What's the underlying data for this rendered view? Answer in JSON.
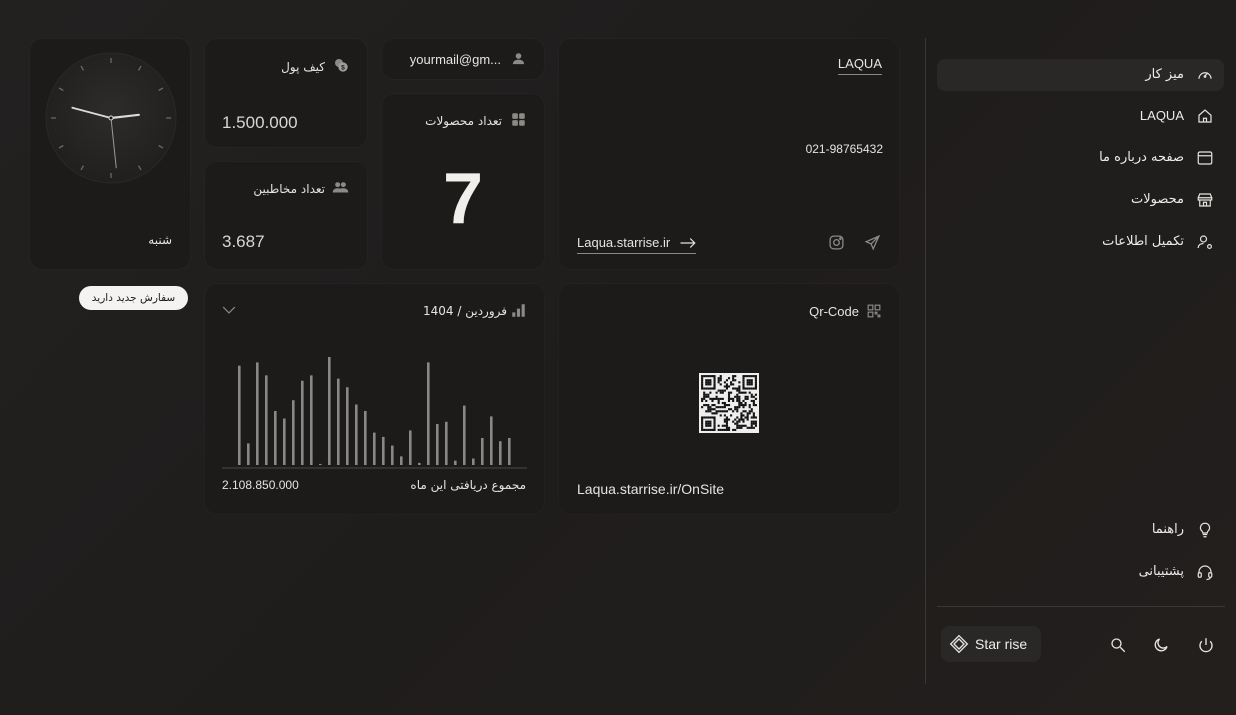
{
  "sidebar": {
    "items": [
      {
        "label": "میز کار",
        "icon": "dashboard-gauge-icon",
        "active": true
      },
      {
        "label": "LAQUA",
        "icon": "home-icon"
      },
      {
        "label": "صفحه درباره ما",
        "icon": "browser-window-icon"
      },
      {
        "label": "محصولات",
        "icon": "store-icon"
      },
      {
        "label": "تکمیل اطلاعات",
        "icon": "user-settings-icon"
      }
    ],
    "help_label": "راهنما",
    "support_label": "پشتیبانی",
    "brand_label": "Star rise"
  },
  "clock": {
    "day_label": "شنبه",
    "hour": 2,
    "minute": 47,
    "second": 29
  },
  "order_notice": "سفارش جدید دارید",
  "wallet": {
    "title": "کیف پول",
    "value": "1.500.000"
  },
  "contacts": {
    "title": "تعداد مخاطبین",
    "value": "3.687"
  },
  "email": {
    "value": "yourmail@gm..."
  },
  "products": {
    "title": "تعداد محصولات",
    "value": "7"
  },
  "company": {
    "name": "LAQUA",
    "phone": "021-98765432",
    "site_link": "Laqua.starrise.ir"
  },
  "income_chart": {
    "period_label": "فروردین / 1404",
    "total_label": "مجموع دریافتی این ماه",
    "total_value": "2.108.850.000"
  },
  "chart_data": {
    "type": "bar",
    "values": [
      92,
      20,
      95,
      83,
      50,
      43,
      60,
      78,
      83,
      1,
      100,
      80,
      72,
      56,
      50,
      30,
      26,
      18,
      8,
      32,
      2,
      95,
      38,
      40,
      4,
      55,
      6,
      25,
      45,
      22,
      25
    ],
    "ylim": [
      0,
      100
    ]
  },
  "qr": {
    "title": "Qr-Code",
    "link": "Laqua.starrise.ir/OnSite"
  },
  "colors": {
    "background": "#211f1e",
    "card": "#1c1b1a",
    "accent_text": "#ececea",
    "bar": "#8a8886"
  }
}
